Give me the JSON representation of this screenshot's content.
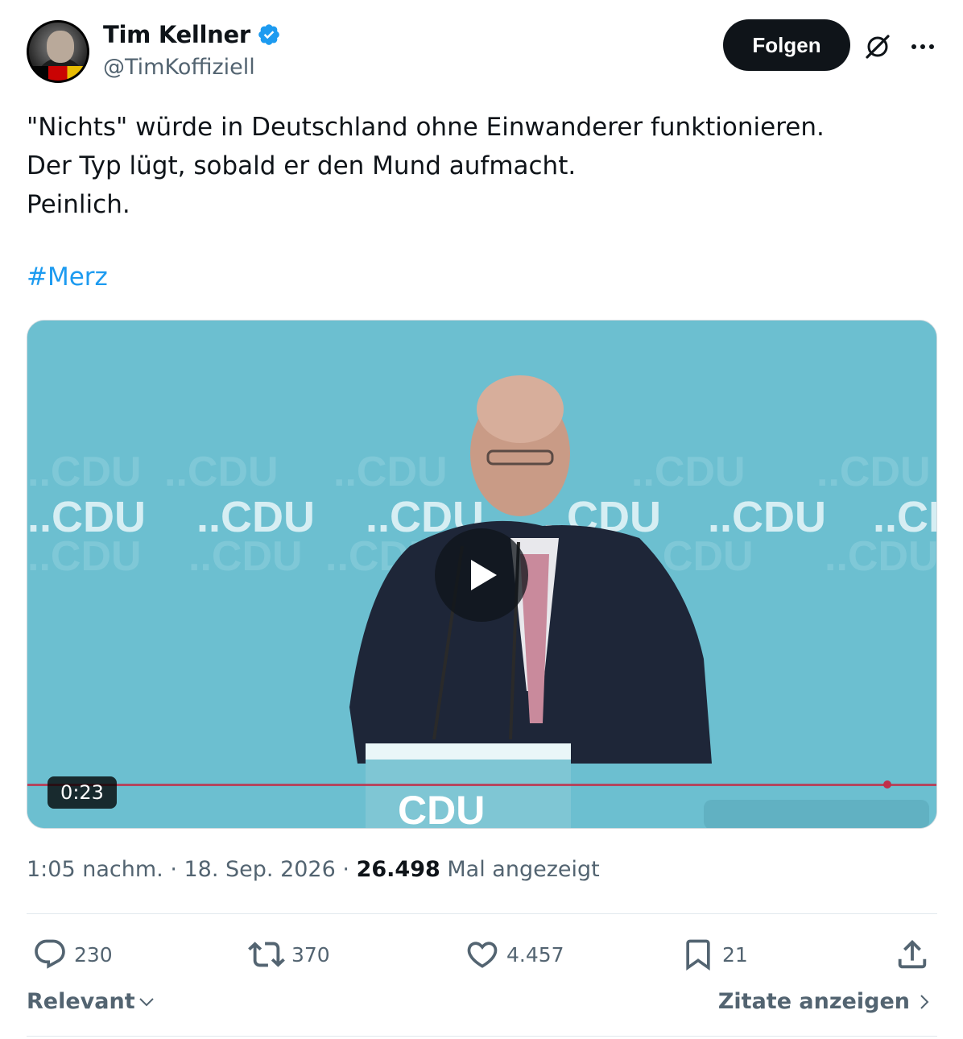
{
  "author": {
    "name": "Tim Kellner",
    "handle": "@TimKoffiziell",
    "verified": true
  },
  "header": {
    "follow_label": "Folgen"
  },
  "tweet": {
    "lines": [
      "\"Nichts\" würde in Deutschland ohne Einwanderer funktionieren.",
      "Der Typ lügt, sobald er den Mund aufmacht.",
      "Peinlich."
    ],
    "hashtag": "#Merz"
  },
  "video": {
    "duration": "0:23",
    "podium_text": "CDU"
  },
  "meta": {
    "time": "1:05 nachm.",
    "separator": "·",
    "date": "18. Sep. 2026",
    "views_count": "26.498",
    "views_label": "Mal angezeigt"
  },
  "actions": {
    "replies": "230",
    "reposts": "370",
    "likes": "4.457",
    "bookmarks": "21"
  },
  "footer": {
    "sort_label": "Relevant",
    "quotes_label": "Zitate anzeigen"
  },
  "colors": {
    "accent": "#1d9bf0",
    "text": "#0f1419",
    "secondary": "#536471",
    "stage_bg": "#6cbfd0"
  }
}
